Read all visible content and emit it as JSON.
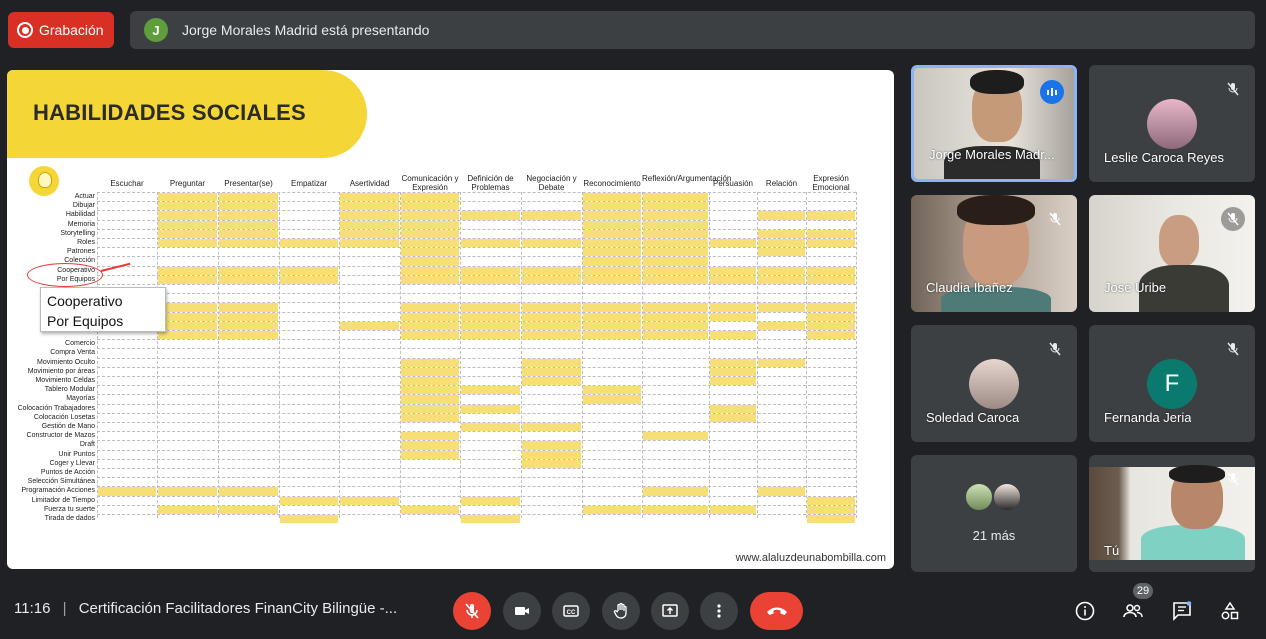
{
  "recording": {
    "label": "Grabación"
  },
  "presenting": {
    "avatar_letter": "J",
    "text": "Jorge Morales Madrid está presentando"
  },
  "slide": {
    "title": "HABILIDADES SOCIALES",
    "url": "www.alaluzdeunabombilla.com",
    "columns": [
      "Escuchar",
      "Preguntar",
      "Presentar(se)",
      "Empatizar",
      "Asertividad",
      "Comunicación y Expresión",
      "Definición de Problemas",
      "Negociación y Debate",
      "Reconocimiento",
      "Reflexión/Argumentación",
      "Persuasión",
      "Relación",
      "Expresión Emocional"
    ],
    "rows_top": [
      "Actuar",
      "Dibujar",
      "Habilidad",
      "Memoria",
      "Storytelling",
      "Roles",
      "Patrones",
      "Colección",
      "Cooperativo",
      "Por Equipos"
    ],
    "rows_bottom": [
      "Comercio",
      "Compra Venta",
      "Movimiento Oculto",
      "Movimiento por áreas",
      "Movimiento Celdas",
      "Tablero Modular",
      "Mayorías",
      "Colocación Trabajadores",
      "Colocación Losetas",
      "Gestión de Mano",
      "Constructor de Mazos",
      "Draft",
      "Unir Puntos",
      "Coger y Llevar",
      "Puntos de Acción",
      "Selección Simultánea",
      "Programación Acciones",
      "Limitador de Tiempo",
      "Fuerza tu suerte",
      "Tirada de dados"
    ],
    "tooltip_line1": "Cooperativo",
    "tooltip_line2": "Por Equipos"
  },
  "participants": [
    {
      "name": "Jorge Morales Madr...",
      "speaking": true
    },
    {
      "name": "Leslie Caroca Reyes",
      "muted": true
    },
    {
      "name": "Claudia Ibañez",
      "muted": true
    },
    {
      "name": "Jose Uribe",
      "muted": true
    },
    {
      "name": "Soledad Caroca",
      "muted": true
    },
    {
      "name": "Fernanda Jeria",
      "avatar_letter": "F",
      "muted": true
    },
    {
      "name": "21 más"
    },
    {
      "name": "Tú",
      "muted": true
    }
  ],
  "bottom": {
    "time": "11:16",
    "separator": "|",
    "meeting_title": "Certificación Facilitadores FinanCity Bilingüe -...",
    "people_count": "29"
  },
  "colors": {
    "accent_red": "#ea4335",
    "slide_yellow": "#f4d637",
    "tile_bg": "#3c4043",
    "speaking_border": "#8ab4f8"
  }
}
